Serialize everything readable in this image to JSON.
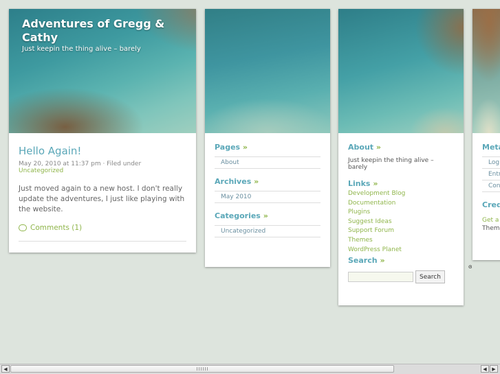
{
  "site": {
    "title": "Adventures of Gregg & Cathy",
    "description": "Just keepin the thing alive – barely"
  },
  "post": {
    "title": "Hello Again!",
    "meta_prefix": "May 20, 2010 at 11:37 pm · Filed under",
    "category": "Uncategorized",
    "body": "Just moved again to a new host. I don't really update the adventures, I just like playing with the website.",
    "comments": "Comments (1)"
  },
  "col2": {
    "pages_heading": "Pages",
    "pages": [
      "About"
    ],
    "archives_heading": "Archives",
    "archives": [
      "May 2010"
    ],
    "categories_heading": "Categories",
    "categories": [
      "Uncategorized"
    ]
  },
  "col3": {
    "about_heading": "About",
    "about_text": "Just keepin the thing alive – barely",
    "links_heading": "Links",
    "links": [
      "Development Blog",
      "Documentation",
      "Plugins",
      "Suggest Ideas",
      "Support Forum",
      "Themes",
      "WordPress Planet"
    ],
    "search_heading": "Search",
    "search_button": "Search",
    "search_value": ""
  },
  "col4": {
    "meta_heading": "Meta",
    "meta_items": [
      "Log",
      "Entr",
      "Con"
    ],
    "credits_heading": "Cred",
    "credits_line1": "Get a",
    "credits_line2": "Theme"
  },
  "raquo": "»",
  "scrollbar": {
    "left_arrow": "◀",
    "right_arrow_left": "◀",
    "right_arrow_right": "▶"
  },
  "icons": {
    "comment": "comment-bubble-icon",
    "cursor": "cursor-icon"
  },
  "colors": {
    "link_blue": "#5aa7b8",
    "link_green": "#8fb54a",
    "background": "#dde4dd"
  }
}
